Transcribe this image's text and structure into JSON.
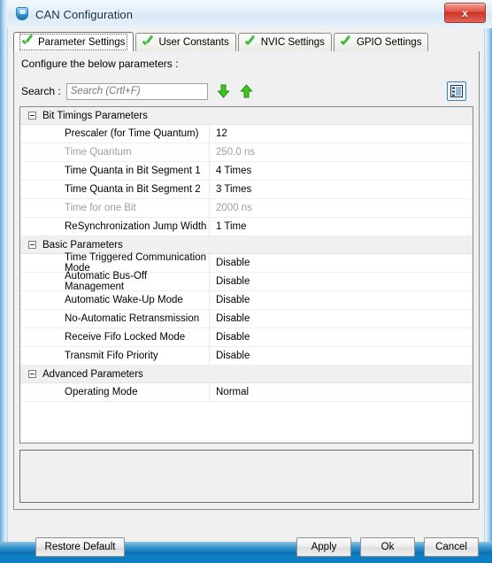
{
  "window": {
    "title": "CAN Configuration",
    "icon": "shield-icon",
    "close_label": "x"
  },
  "tabs": [
    {
      "label": "Parameter Settings",
      "active": true,
      "icon": "green-check-icon"
    },
    {
      "label": "User Constants",
      "active": false,
      "icon": "green-check-icon"
    },
    {
      "label": "NVIC Settings",
      "active": false,
      "icon": "green-check-icon"
    },
    {
      "label": "GPIO Settings",
      "active": false,
      "icon": "green-check-icon"
    }
  ],
  "panel": {
    "instruction": "Configure the below parameters :",
    "search": {
      "label": "Search :",
      "value": "",
      "placeholder": "Search (Crtl+F)",
      "next_icon": "arrow-down-icon",
      "prev_icon": "arrow-up-icon",
      "view_toggle_icon": "list-view-icon"
    }
  },
  "tree": {
    "groups": [
      {
        "title": "Bit Timings Parameters",
        "expanded": true,
        "rows": [
          {
            "name": "Prescaler (for Time Quantum)",
            "value": "12",
            "disabled": false
          },
          {
            "name": "Time Quantum",
            "value": "250.0 ns",
            "disabled": true
          },
          {
            "name": "Time Quanta in Bit Segment 1",
            "value": "4 Times",
            "disabled": false
          },
          {
            "name": "Time Quanta in Bit Segment 2",
            "value": "3 Times",
            "disabled": false
          },
          {
            "name": "Time for one Bit",
            "value": "2000 ns",
            "disabled": true
          },
          {
            "name": "ReSynchronization Jump Width",
            "value": "1 Time",
            "disabled": false
          }
        ]
      },
      {
        "title": "Basic Parameters",
        "expanded": true,
        "rows": [
          {
            "name": "Time Triggered Communication Mode",
            "value": "Disable",
            "disabled": false
          },
          {
            "name": "Automatic Bus-Off Management",
            "value": "Disable",
            "disabled": false
          },
          {
            "name": "Automatic Wake-Up Mode",
            "value": "Disable",
            "disabled": false
          },
          {
            "name": "No-Automatic Retransmission",
            "value": "Disable",
            "disabled": false
          },
          {
            "name": "Receive Fifo Locked Mode",
            "value": "Disable",
            "disabled": false
          },
          {
            "name": "Transmit Fifo Priority",
            "value": "Disable",
            "disabled": false
          }
        ]
      },
      {
        "title": "Advanced Parameters",
        "expanded": true,
        "rows": [
          {
            "name": "Operating Mode",
            "value": "Normal",
            "disabled": false
          }
        ]
      }
    ]
  },
  "buttons": {
    "restore_default": "Restore Default",
    "apply": "Apply",
    "ok": "Ok",
    "cancel": "Cancel"
  },
  "colors": {
    "accent_blue": "#0e7ec4",
    "check_green": "#3fbb3f",
    "arrow_green": "#35c026",
    "close_red": "#cc3426",
    "disabled_text": "#a0a0a0"
  }
}
